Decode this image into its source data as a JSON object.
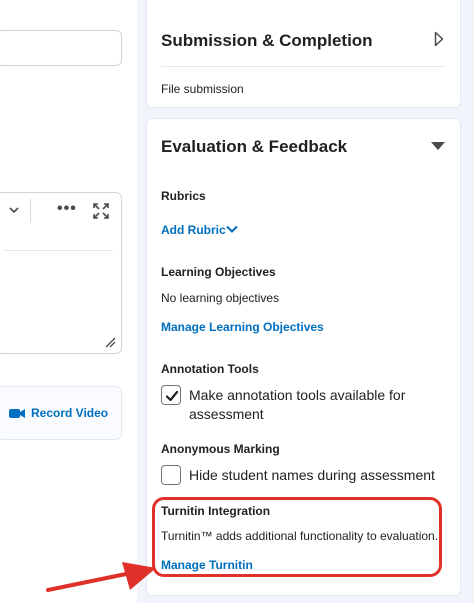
{
  "left": {
    "record_video_label": "Record Video"
  },
  "submission_card": {
    "title": "Submission & Completion",
    "summary": "File submission"
  },
  "evaluation_card": {
    "title": "Evaluation & Feedback",
    "rubrics": {
      "label": "Rubrics",
      "add_link": "Add Rubric"
    },
    "learning_objectives": {
      "label": "Learning Objectives",
      "value": "No learning objectives",
      "manage_link": "Manage Learning Objectives"
    },
    "annotation_tools": {
      "label": "Annotation Tools",
      "checkbox_label": "Make annotation tools available for assessment",
      "checked": true
    },
    "anonymous_marking": {
      "label": "Anonymous Marking",
      "checkbox_label": "Hide student names during assessment",
      "checked": false
    },
    "turnitin": {
      "label": "Turnitin Integration",
      "description": "Turnitin™ adds additional functionality to evaluation.",
      "manage_link": "Manage Turnitin"
    }
  },
  "colors": {
    "link": "#006fbf",
    "highlight": "#e0302a",
    "panel_bg": "#f1f5fb"
  }
}
